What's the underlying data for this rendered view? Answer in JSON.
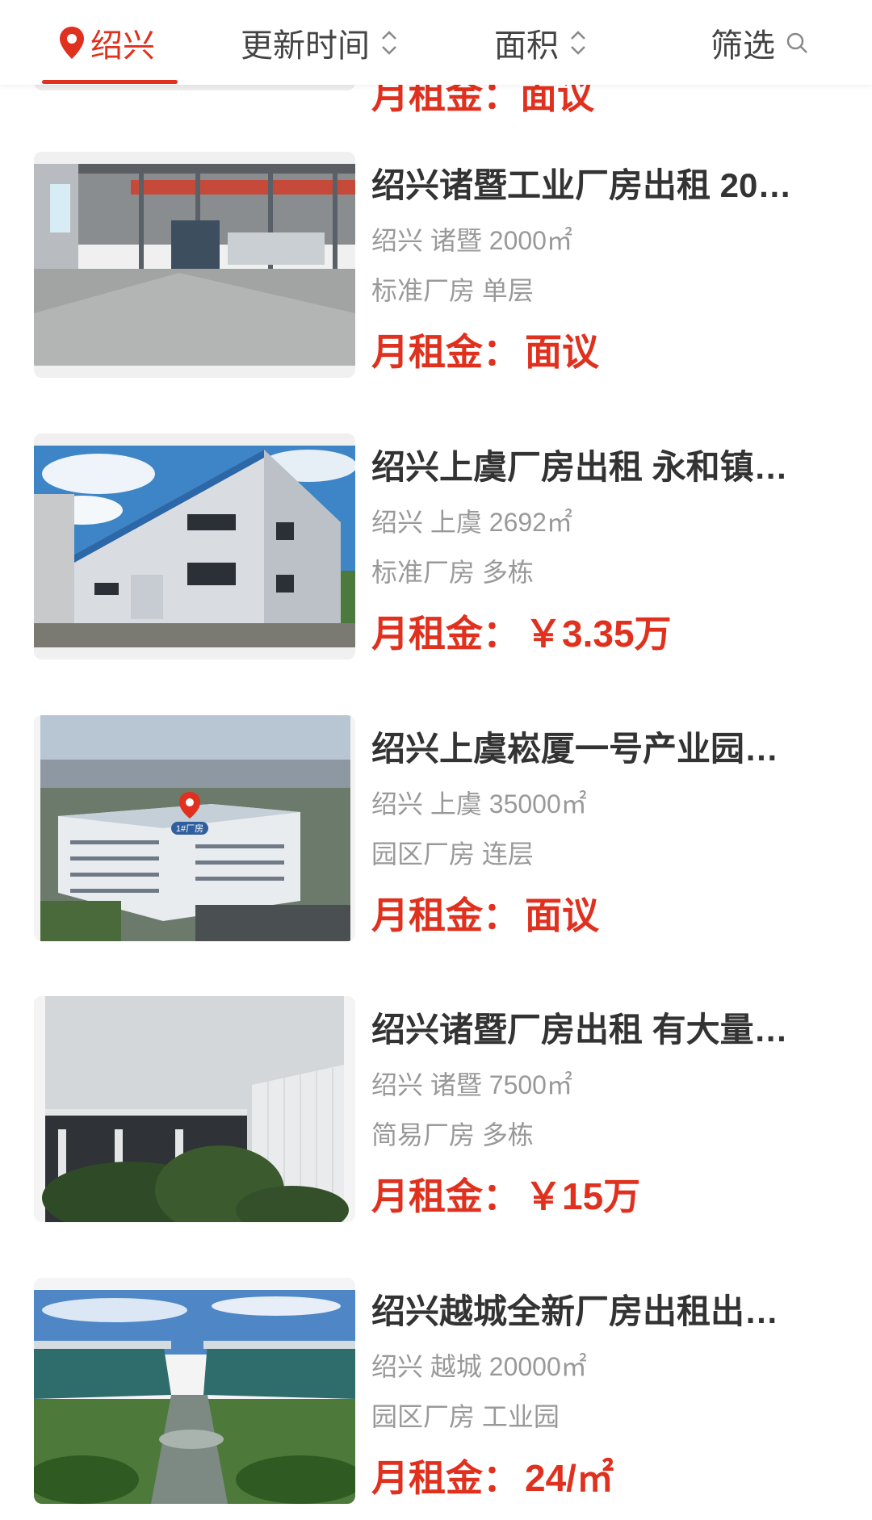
{
  "filter_bar": {
    "city": "绍兴",
    "sort_time": "更新时间",
    "sort_area": "面积",
    "filter": "筛选"
  },
  "previous_item": {
    "price_label": "月租金：",
    "price_value": "面议"
  },
  "listings": [
    {
      "title": "绍兴诸暨工业厂房出租 20…",
      "location": "绍兴 诸暨 2000㎡",
      "tags": "标准厂房 单层",
      "price_label": "月租金：",
      "price_value": "面议",
      "photo": "factory-interior"
    },
    {
      "title": "绍兴上虞厂房出租 永和镇…",
      "location": "绍兴 上虞 2692㎡",
      "tags": "标准厂房 多栋",
      "price_label": "月租金：",
      "price_value": "￥3.35万",
      "photo": "factory-exterior-blue-sky"
    },
    {
      "title": "绍兴上虞崧厦一号产业园…",
      "location": "绍兴 上虞 35000㎡",
      "tags": "园区厂房 连层",
      "price_label": "月租金：",
      "price_value": "面议",
      "photo": "industrial-park-aerial",
      "photo_marker": "1#厂房"
    },
    {
      "title": "绍兴诸暨厂房出租 有大量…",
      "location": "绍兴 诸暨 7500㎡",
      "tags": "简易厂房 多栋",
      "price_label": "月租金：",
      "price_value": "￥15万",
      "photo": "factory-with-trees"
    },
    {
      "title": "绍兴越城全新厂房出租出…",
      "location": "绍兴 越城 20000㎡",
      "tags": "园区厂房 工业园",
      "price_label": "月租金：",
      "price_value": "24/㎡",
      "photo": "new-industrial-park"
    }
  ],
  "colors": {
    "accent": "#e0301e",
    "text": "#333333",
    "muted": "#999999"
  }
}
